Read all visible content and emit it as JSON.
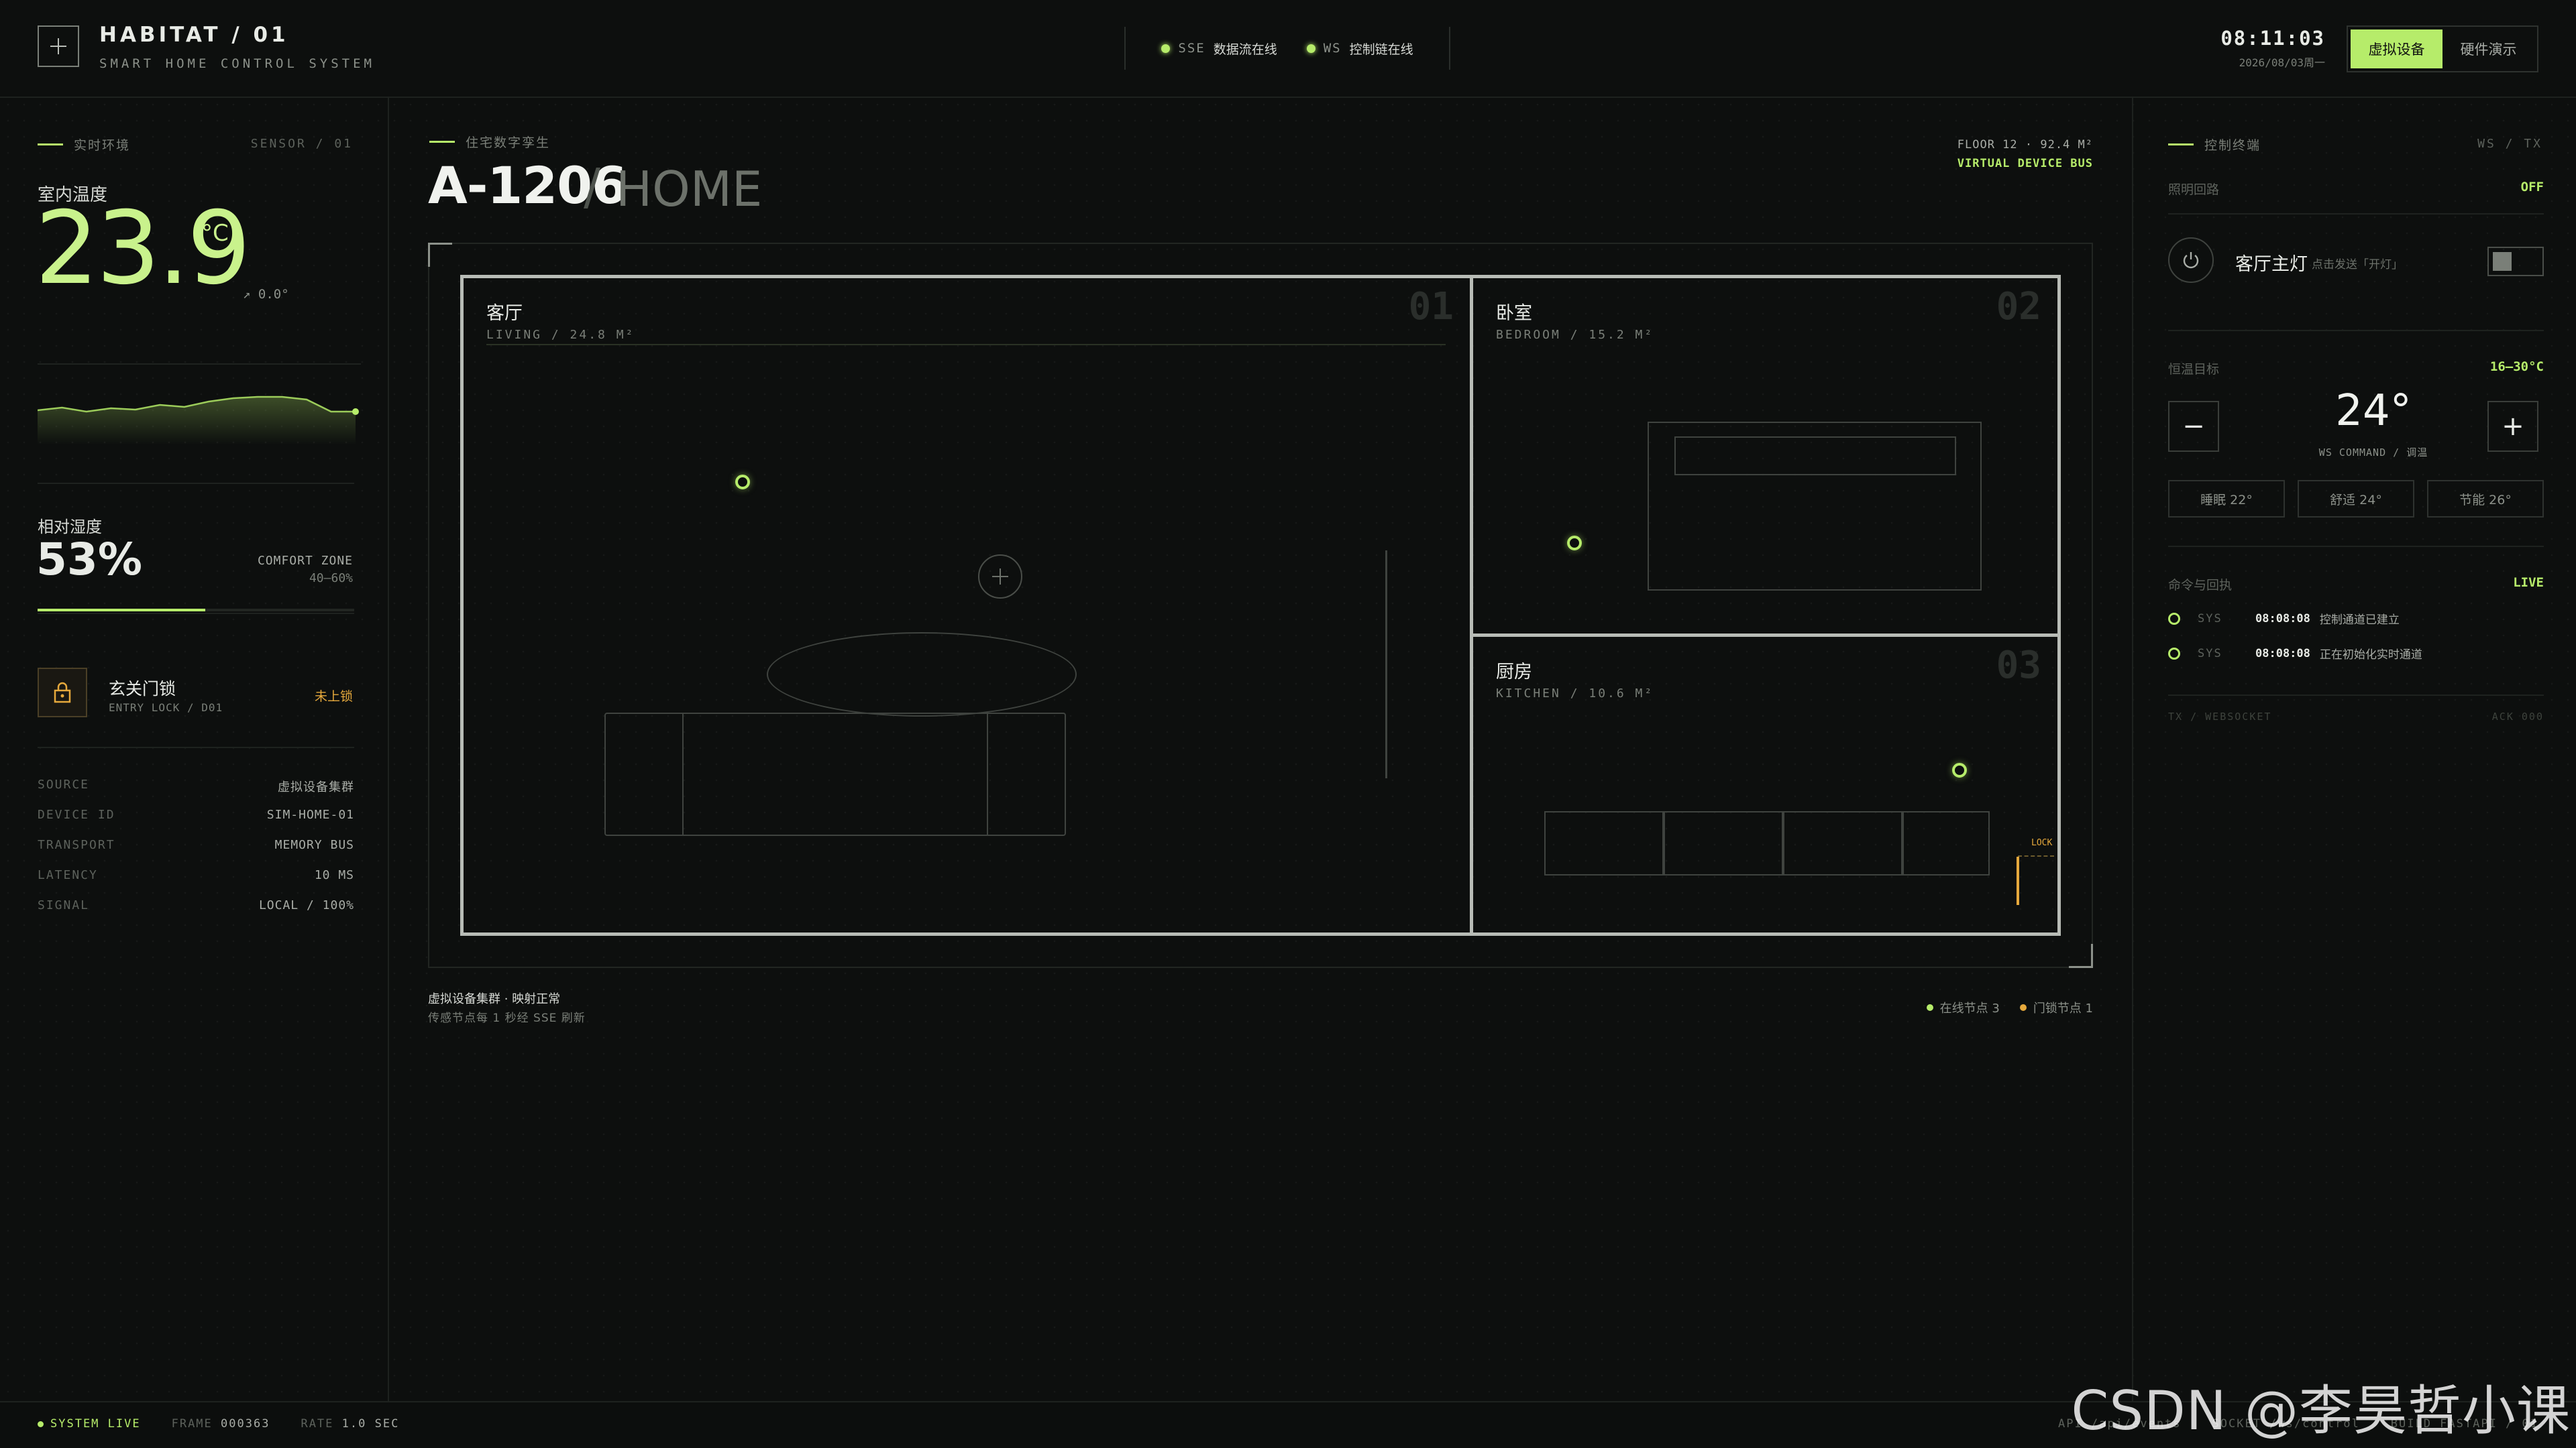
{
  "header": {
    "title": "HABITAT / 01",
    "subtitle": "SMART HOME CONTROL SYSTEM",
    "status": [
      {
        "tag": "SSE",
        "text": "数据流在线"
      },
      {
        "tag": "WS",
        "text": "控制链在线"
      }
    ],
    "clock": "08:11:03",
    "date": "2026/08/03周一",
    "modes": [
      "虚拟设备",
      "硬件演示"
    ],
    "active_mode": "虚拟设备"
  },
  "left": {
    "section_title": "实时环境",
    "section_tag": "SENSOR / 01",
    "temp_label": "室内温度",
    "temp_value": "23.9",
    "temp_unit": "°C",
    "temp_trend": "↗ 0.0°",
    "sparkline": [
      0.42,
      0.46,
      0.4,
      0.45,
      0.43,
      0.5,
      0.47,
      0.55,
      0.6,
      0.62,
      0.62,
      0.58,
      0.4,
      0.4
    ],
    "hum_label": "相对湿度",
    "hum_value": "53%",
    "hum_fraction": 0.53,
    "comfort_label": "COMFORT ZONE",
    "comfort_range": "40–60%",
    "lock_name": "玄关门锁",
    "lock_sub": "ENTRY LOCK / D01",
    "lock_status": "未上锁",
    "info": [
      {
        "key": "SOURCE",
        "val": "虚拟设备集群"
      },
      {
        "key": "DEVICE ID",
        "val": "SIM-HOME-01"
      },
      {
        "key": "TRANSPORT",
        "val": "MEMORY BUS"
      },
      {
        "key": "LATENCY",
        "val": "10 MS"
      },
      {
        "key": "SIGNAL",
        "val": "LOCAL / 100%"
      }
    ]
  },
  "main": {
    "label": "住宅数字孪生",
    "unit_id": "A-1206",
    "unit_sep": "/",
    "unit_suffix": "HOME",
    "floor_info": "FLOOR 12 · 92.4 M²",
    "bus_info": "VIRTUAL DEVICE BUS",
    "rooms": [
      {
        "name": "客厅",
        "meta": "LIVING / 24.8 M²",
        "num": "01"
      },
      {
        "name": "卧室",
        "meta": "BEDROOM / 15.2 M²",
        "num": "02"
      },
      {
        "name": "厨房",
        "meta": "KITCHEN / 10.6 M²",
        "num": "03"
      }
    ],
    "lock_tag": "LOCK",
    "foot_title": "虚拟设备集群 · 映射正常",
    "foot_sub": "传感节点每 1 秒经 SSE 刷新",
    "legend": [
      {
        "label": "在线节点 3",
        "color": "#b6ec6a"
      },
      {
        "label": "门锁节点 1",
        "color": "#e6a93c"
      }
    ]
  },
  "right": {
    "section_title": "控制终端",
    "section_tag": "WS / TX",
    "light_row_label": "照明回路",
    "light_row_value": "OFF",
    "light_name": "客厅主灯",
    "light_hint": "点击发送「开灯」",
    "thermo_label": "恒温目标",
    "thermo_range": "16–30°C",
    "setpoint": "24°",
    "minus": "−",
    "plus": "+",
    "setpoint_cmd": "WS COMMAND / 调温",
    "presets": [
      "睡眠 22°",
      "舒适 24°",
      "节能 26°"
    ],
    "log_label": "命令与回执",
    "log_state": "LIVE",
    "logs": [
      {
        "src": "SYS",
        "time": "08:08:08",
        "text": "控制通道已建立"
      },
      {
        "src": "SYS",
        "time": "08:08:08",
        "text": "正在初始化实时通道"
      }
    ],
    "tx_label": "TX / WEBSOCKET",
    "tx_ack": "ACK 000"
  },
  "footer": {
    "system": "SYSTEM LIVE",
    "frame_label": "FRAME",
    "frame_value": "000363",
    "rate_label": "RATE",
    "rate_value": "1.0 SEC",
    "api": "API /api/events",
    "socket": "SOCKET /ws/control",
    "build": "BUILD FASTAPI / 01"
  },
  "watermark": "CSDN @李昊哲小课"
}
